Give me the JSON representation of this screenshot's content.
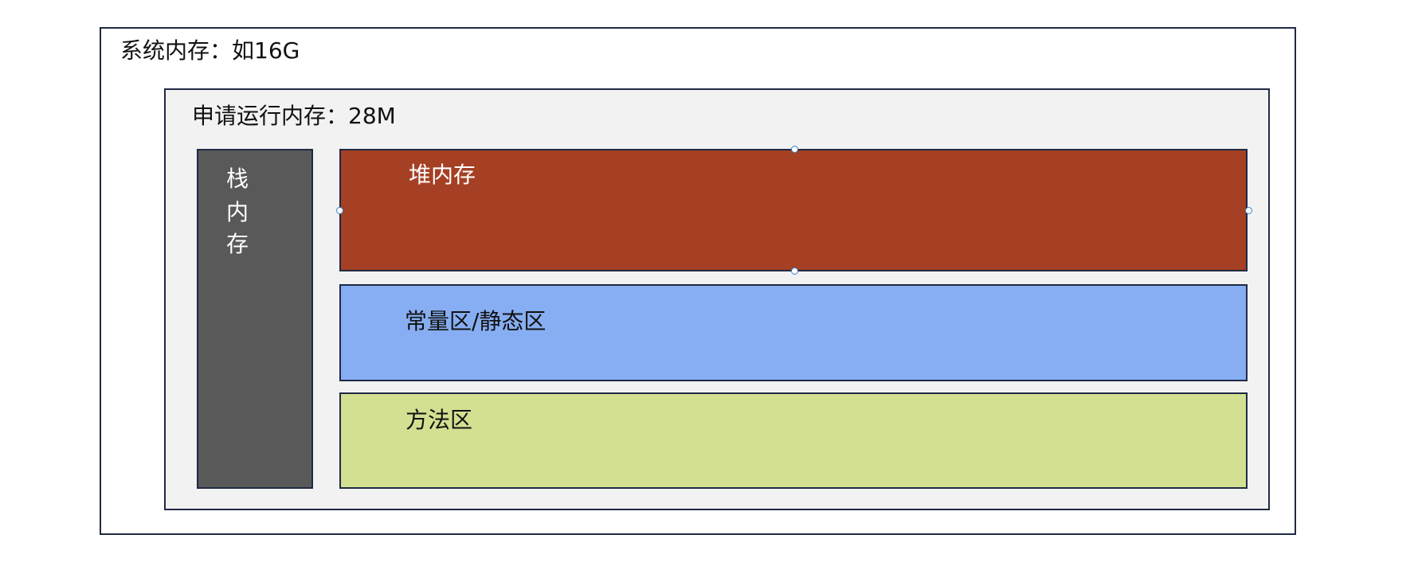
{
  "diagram": {
    "system_memory": {
      "label": "系统内存：如16G"
    },
    "run_memory": {
      "label": "申请运行内存：28M"
    },
    "stack": {
      "chars": [
        "栈",
        "内",
        "存"
      ]
    },
    "heap": {
      "label": "堆内存"
    },
    "constant_area": {
      "label": "常量区/静态区"
    },
    "method_area": {
      "label": "方法区"
    }
  },
  "colors": {
    "border": "#1f2a44",
    "system_bg": "#ffffff",
    "run_bg": "#f2f2f2",
    "stack_bg": "#595959",
    "heap_bg": "#a54024",
    "constant_bg": "#87aef2",
    "method_bg": "#d3e091",
    "handle_stroke": "#3b82c4"
  }
}
